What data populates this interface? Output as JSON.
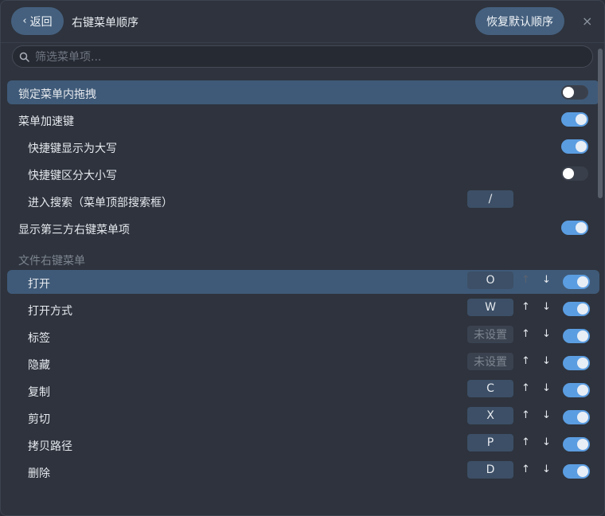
{
  "header": {
    "back_label": "返回",
    "title": "右键菜单顺序",
    "restore_label": "恢复默认顺序",
    "close_glyph": "×"
  },
  "search": {
    "placeholder": "筛选菜单项..."
  },
  "settings": [
    {
      "label": "锁定菜单内拖拽",
      "toggle": "off",
      "selected": true
    },
    {
      "label": "菜单加速键",
      "toggle": "on"
    },
    {
      "label": "快捷键显示为大写",
      "toggle": "on",
      "indent": true
    },
    {
      "label": "快捷键区分大小写",
      "toggle": "off",
      "indent": true
    },
    {
      "label": "进入搜索（菜单顶部搜索框）",
      "key": "/",
      "indent": true
    },
    {
      "label": "显示第三方右键菜单项",
      "toggle": "on"
    }
  ],
  "section_title": "文件右键菜单",
  "menu_items": [
    {
      "label": "打开",
      "key": "O",
      "toggle": "on",
      "selected": true,
      "up_disabled": true
    },
    {
      "label": "打开方式",
      "key": "W",
      "toggle": "on"
    },
    {
      "label": "标签",
      "key": "未设置",
      "key_unset": true,
      "toggle": "on"
    },
    {
      "label": "隐藏",
      "key": "未设置",
      "key_unset": true,
      "toggle": "on"
    },
    {
      "label": "复制",
      "key": "C",
      "toggle": "on"
    },
    {
      "label": "剪切",
      "key": "X",
      "toggle": "on"
    },
    {
      "label": "拷贝路径",
      "key": "P",
      "toggle": "on"
    },
    {
      "label": "删除",
      "key": "D",
      "toggle": "on"
    }
  ],
  "arrow_up": "↑",
  "arrow_down": "↓"
}
